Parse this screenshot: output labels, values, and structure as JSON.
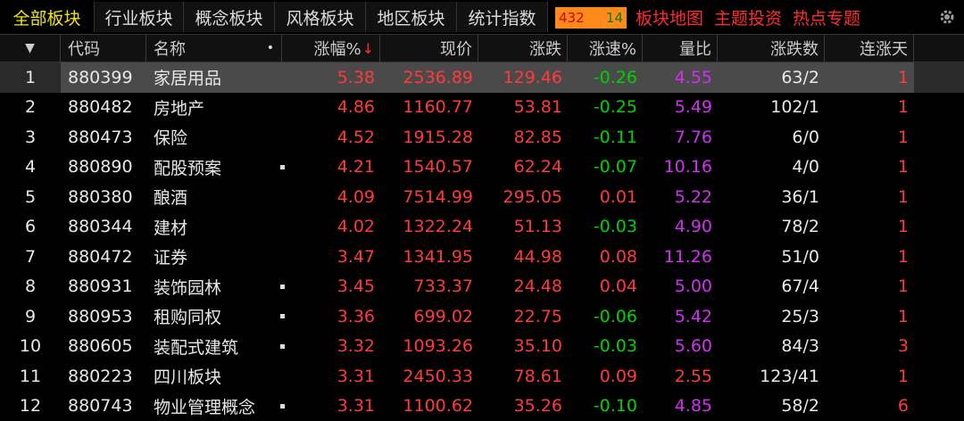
{
  "tabs": [
    {
      "label": "全部板块",
      "active": true
    },
    {
      "label": "行业板块",
      "active": false
    },
    {
      "label": "概念板块",
      "active": false
    },
    {
      "label": "风格板块",
      "active": false
    },
    {
      "label": "地区板块",
      "active": false
    },
    {
      "label": "统计指数",
      "active": false
    }
  ],
  "counter": {
    "up": "432",
    "down": "14"
  },
  "links": [
    "板块地图",
    "主题投资",
    "热点专题"
  ],
  "gear_icon": "gear-icon",
  "header": {
    "menu": "▼",
    "code": "代码",
    "name": "名称",
    "name_dot": "•",
    "change_pct": "涨幅%",
    "sort_arrow": "↓",
    "price": "现价",
    "change": "涨跌",
    "speed": "涨速%",
    "vol_ratio": "量比",
    "updown": "涨跌数",
    "streak": "连涨天"
  },
  "colors": {
    "up": "#ff3a3a",
    "down": "#00d200",
    "purple": "#d230f0",
    "accent": "#f1e40c"
  },
  "rows": [
    {
      "no": "1",
      "code": "880399",
      "name": "家居用品",
      "dot": false,
      "pct": "5.38",
      "price": "2536.89",
      "chg": "129.46",
      "speed": "-0.26",
      "speed_dir": "down",
      "ratio": "4.55",
      "ratio_color": "purple",
      "ud": "63/2",
      "streak": "1"
    },
    {
      "no": "2",
      "code": "880482",
      "name": "房地产",
      "dot": false,
      "pct": "4.86",
      "price": "1160.77",
      "chg": "53.81",
      "speed": "-0.25",
      "speed_dir": "down",
      "ratio": "5.49",
      "ratio_color": "purple",
      "ud": "102/1",
      "streak": "1"
    },
    {
      "no": "3",
      "code": "880473",
      "name": "保险",
      "dot": false,
      "pct": "4.52",
      "price": "1915.28",
      "chg": "82.85",
      "speed": "-0.11",
      "speed_dir": "down",
      "ratio": "7.76",
      "ratio_color": "purple",
      "ud": "6/0",
      "streak": "1"
    },
    {
      "no": "4",
      "code": "880890",
      "name": "配股预案",
      "dot": true,
      "pct": "4.21",
      "price": "1540.57",
      "chg": "62.24",
      "speed": "-0.07",
      "speed_dir": "down",
      "ratio": "10.16",
      "ratio_color": "purple",
      "ud": "4/0",
      "streak": "1"
    },
    {
      "no": "5",
      "code": "880380",
      "name": "酿酒",
      "dot": false,
      "pct": "4.09",
      "price": "7514.99",
      "chg": "295.05",
      "speed": "0.01",
      "speed_dir": "up",
      "ratio": "5.22",
      "ratio_color": "purple",
      "ud": "36/1",
      "streak": "1"
    },
    {
      "no": "6",
      "code": "880344",
      "name": "建材",
      "dot": false,
      "pct": "4.02",
      "price": "1322.24",
      "chg": "51.13",
      "speed": "-0.03",
      "speed_dir": "down",
      "ratio": "4.90",
      "ratio_color": "purple",
      "ud": "78/2",
      "streak": "1"
    },
    {
      "no": "7",
      "code": "880472",
      "name": "证券",
      "dot": false,
      "pct": "3.47",
      "price": "1341.95",
      "chg": "44.98",
      "speed": "0.08",
      "speed_dir": "up",
      "ratio": "11.26",
      "ratio_color": "purple",
      "ud": "51/0",
      "streak": "1"
    },
    {
      "no": "8",
      "code": "880931",
      "name": "装饰园林",
      "dot": true,
      "pct": "3.45",
      "price": "733.37",
      "chg": "24.48",
      "speed": "0.04",
      "speed_dir": "up",
      "ratio": "5.00",
      "ratio_color": "purple",
      "ud": "67/4",
      "streak": "1"
    },
    {
      "no": "9",
      "code": "880953",
      "name": "租购同权",
      "dot": true,
      "pct": "3.36",
      "price": "699.02",
      "chg": "22.75",
      "speed": "-0.06",
      "speed_dir": "down",
      "ratio": "5.42",
      "ratio_color": "purple",
      "ud": "25/3",
      "streak": "1"
    },
    {
      "no": "10",
      "code": "880605",
      "name": "装配式建筑",
      "dot": true,
      "pct": "3.32",
      "price": "1093.26",
      "chg": "35.10",
      "speed": "-0.03",
      "speed_dir": "down",
      "ratio": "5.60",
      "ratio_color": "purple",
      "ud": "84/3",
      "streak": "3"
    },
    {
      "no": "11",
      "code": "880223",
      "name": "四川板块",
      "dot": false,
      "pct": "3.31",
      "price": "2450.33",
      "chg": "78.61",
      "speed": "0.09",
      "speed_dir": "up",
      "ratio": "2.55",
      "ratio_color": "red",
      "ud": "123/41",
      "streak": "1"
    },
    {
      "no": "12",
      "code": "880743",
      "name": "物业管理概念",
      "dot": true,
      "pct": "3.31",
      "price": "1100.62",
      "chg": "35.26",
      "speed": "-0.10",
      "speed_dir": "down",
      "ratio": "4.85",
      "ratio_color": "purple",
      "ud": "58/2",
      "streak": "6"
    }
  ]
}
